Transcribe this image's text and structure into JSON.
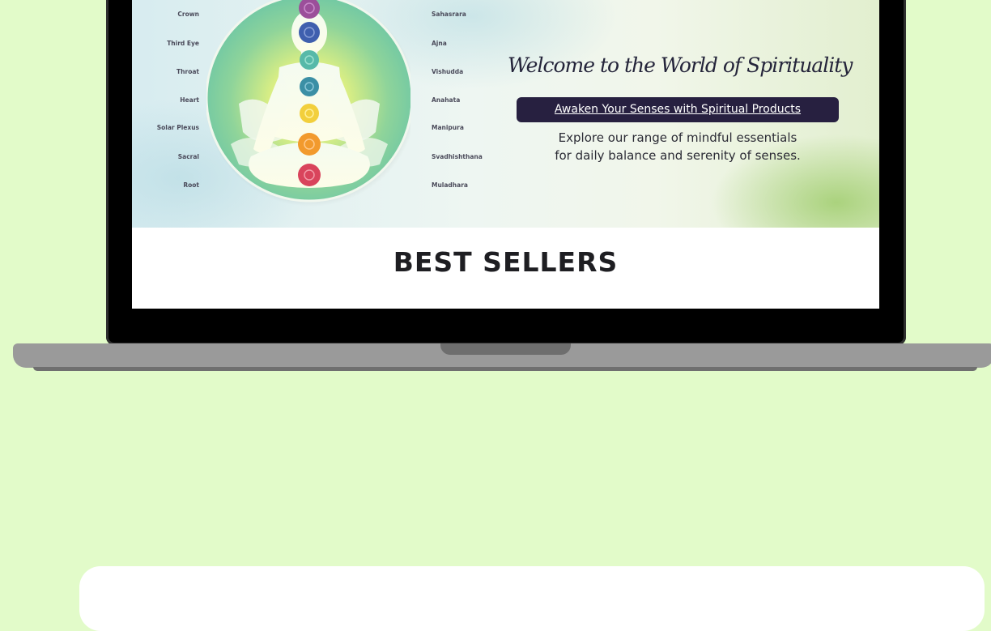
{
  "hero": {
    "chakras_left": [
      "Crown",
      "Third Eye",
      "Throat",
      "Heart",
      "Solar Plexus",
      "Sacral",
      "Root"
    ],
    "chakras_right": [
      "Sahasrara",
      "Ajna",
      "Vishudda",
      "Anahata",
      "Manipura",
      "Svadhishthana",
      "Muladhara"
    ],
    "chakra_colors": [
      "#9b4f9a",
      "#3f5fae",
      "#57b9a9",
      "#3b8fa5",
      "#f2cf3c",
      "#f29a2d",
      "#d9445c"
    ],
    "welcome_title": "Welcome to the World of Spirituality",
    "awaken_link": "Awaken Your Senses with Spiritual Products",
    "explore_line1": "Explore our range of mindful essentials",
    "explore_line2": "for daily balance and serenity of senses."
  },
  "section": {
    "title": "BEST SELLERS"
  },
  "colors": {
    "background": "#e2fbc9",
    "button_bg": "#272040",
    "laptop_body": "#9a9a9a"
  }
}
